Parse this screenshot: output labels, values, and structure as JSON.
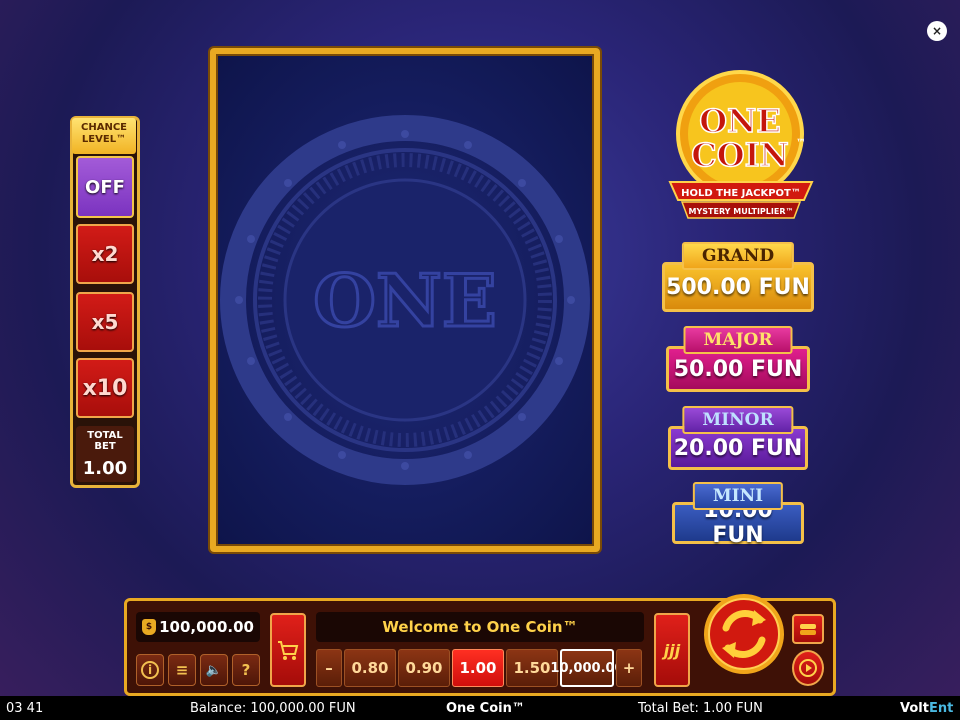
{
  "game_title": "One Coin™",
  "close_label": "×",
  "chance_level": {
    "title_line1": "CHANCE",
    "title_line2": "LEVEL™",
    "options": [
      "OFF",
      "x2",
      "x5",
      "x10"
    ],
    "total_bet_label": "TOTAL BET",
    "total_bet_value": "1.00"
  },
  "reel": {
    "coin_text": "ONE"
  },
  "logo": {
    "line1": "ONE",
    "line2": "COIN",
    "tm": "™",
    "ribbon1": "HOLD THE JACKPOT™",
    "ribbon2": "MYSTERY MULTIPLIER™"
  },
  "jackpots": [
    {
      "name": "GRAND",
      "amount": "500.00 FUN"
    },
    {
      "name": "MAJOR",
      "amount": "50.00 FUN"
    },
    {
      "name": "MINOR",
      "amount": "20.00 FUN"
    },
    {
      "name": "MINI",
      "amount": "10.00 FUN"
    }
  ],
  "controls": {
    "balance_icon": "$",
    "balance_value": "100,000.00",
    "welcome_message": "Welcome to One Coin™",
    "minus_label": "–",
    "plus_label": "+",
    "bet_options": [
      "0.80",
      "0.90",
      "1.00",
      "1.50",
      "10,000.00"
    ],
    "active_bet": "1.00",
    "info_label": "i",
    "menu_label": "≡",
    "sound_label": "🔈",
    "help_label": "?",
    "autoplay_label": "jjj"
  },
  "status_bar": {
    "time": "03 41",
    "balance": "Balance: 100,000.00 FUN",
    "game": "One Coin™",
    "total_bet": "Total Bet: 1.00 FUN",
    "brand_a": "Volt",
    "brand_b": "Ent"
  },
  "colors": {
    "gold": "#e9a922",
    "grand": "#f3b92a",
    "major": "#c8187a",
    "minor": "#6b2ab5",
    "mini": "#2a4aa8"
  }
}
